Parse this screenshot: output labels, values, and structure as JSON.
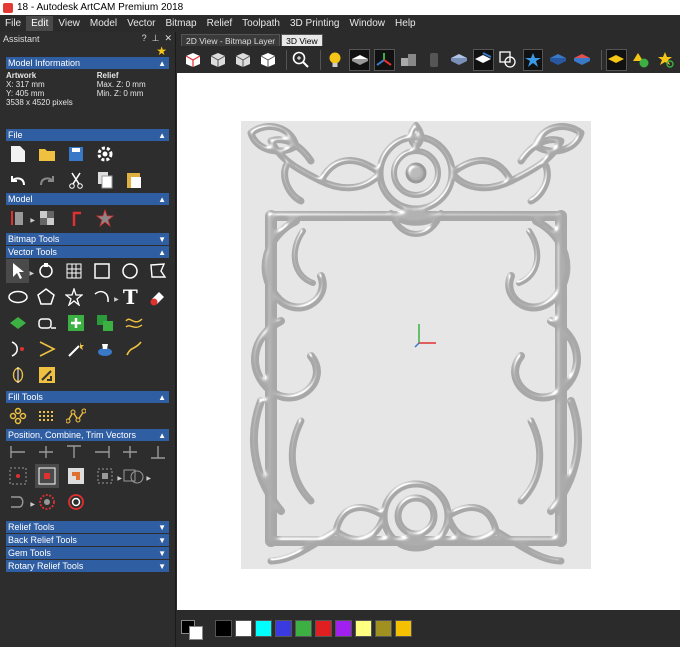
{
  "window": {
    "title": "18 - Autodesk ArtCAM Premium 2018"
  },
  "menu": [
    "File",
    "Edit",
    "View",
    "Model",
    "Vector",
    "Bitmap",
    "Relief",
    "Toolpath",
    "3D Printing",
    "Window",
    "Help"
  ],
  "menu_active": "Edit",
  "assistant": {
    "title": "Assistant",
    "head_buttons": [
      "?",
      "✕"
    ]
  },
  "model_information": {
    "header": "Model Information",
    "artwork_title": "Artwork",
    "relief_title": "Relief",
    "artwork_lines": [
      "X: 317 mm",
      "Y: 405 mm",
      "3538 x 4520 pixels"
    ],
    "relief_lines": [
      "Max. Z: 0 mm",
      "Min. Z: 0 mm"
    ]
  },
  "sections": {
    "file": "File",
    "model": "Model",
    "bitmap_tools": "Bitmap Tools",
    "vector_tools": "Vector Tools",
    "fill_tools": "Fill Tools",
    "position_tools": "Position, Combine, Trim Vectors",
    "relief_tools": "Relief Tools",
    "back_relief_tools": "Back Relief Tools",
    "gem_tools": "Gem Tools",
    "rotary_relief_tools": "Rotary Relief Tools"
  },
  "view_tabs": [
    "2D View - Bitmap Layer",
    "3D View"
  ],
  "active_tab": "3D View",
  "palette": [
    "#000000",
    "#ffffff",
    "#00ffff",
    "#3a3ae0",
    "#3cb043",
    "#e02020",
    "#a020f0",
    "#ffff80",
    "#a09020",
    "#f5c000"
  ],
  "colors": {
    "section_header": "#2f5ea3",
    "panel_bg": "#2d2d2d",
    "relief_bg": "#e6e6e6"
  }
}
